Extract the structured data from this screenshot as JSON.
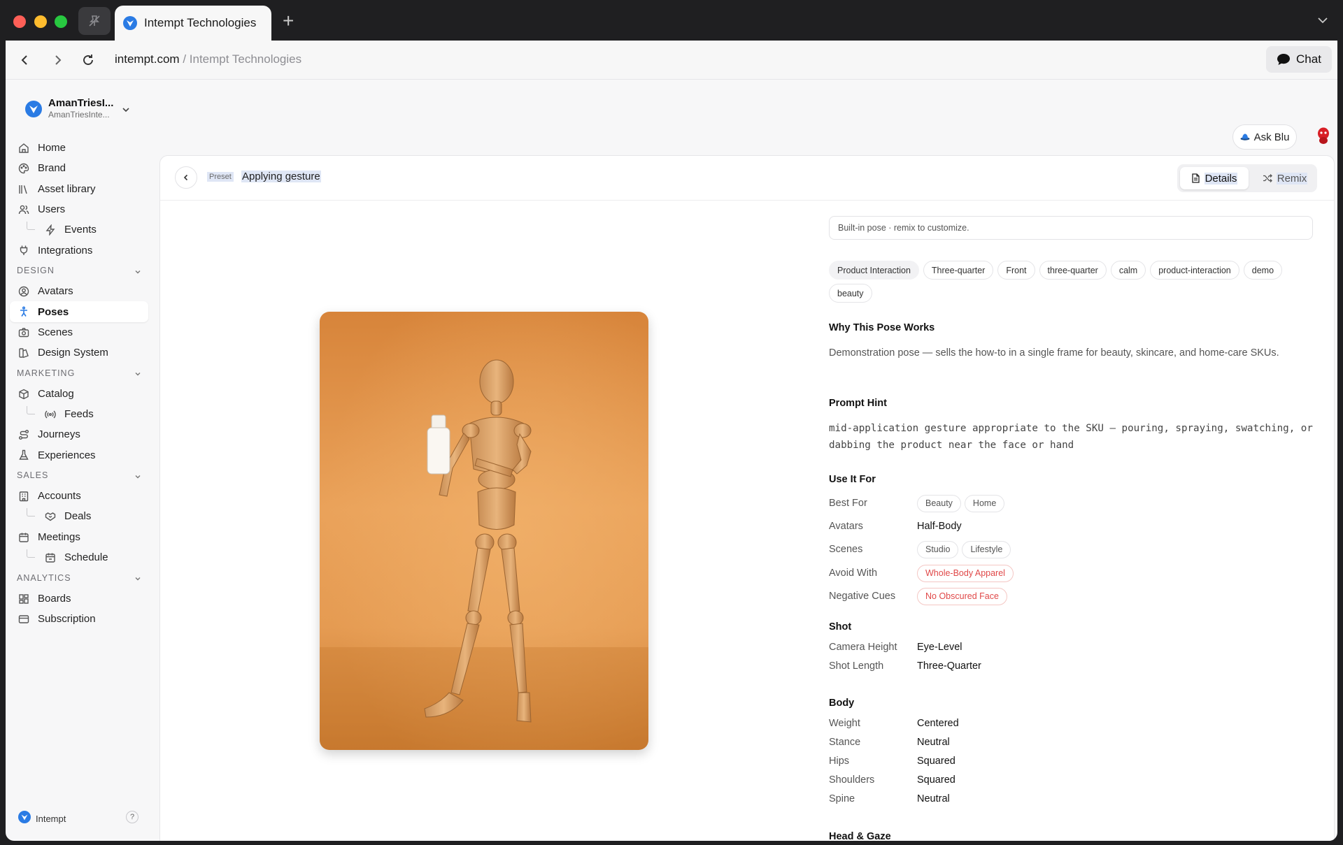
{
  "browser": {
    "tab_title": "Intempt Technologies",
    "url_domain": "intempt.com",
    "url_separator": " / ",
    "url_page_title": "Intempt Technologies",
    "chat_label": "Chat"
  },
  "org": {
    "name": "AmanTriesI...",
    "subtitle": "AmanTriesInte..."
  },
  "sidebar": {
    "items": [
      {
        "label": "Home"
      },
      {
        "label": "Brand"
      },
      {
        "label": "Asset library"
      },
      {
        "label": "Users"
      },
      {
        "label": "Events"
      },
      {
        "label": "Integrations"
      }
    ],
    "design_section": "DESIGN",
    "design_items": [
      {
        "label": "Avatars"
      },
      {
        "label": "Poses"
      },
      {
        "label": "Scenes"
      },
      {
        "label": "Design System"
      }
    ],
    "marketing_section": "MARKETING",
    "marketing_items": [
      {
        "label": "Catalog"
      },
      {
        "label": "Feeds"
      },
      {
        "label": "Journeys"
      },
      {
        "label": "Experiences"
      }
    ],
    "sales_section": "SALES",
    "sales_items": [
      {
        "label": "Accounts"
      },
      {
        "label": "Deals"
      },
      {
        "label": "Meetings"
      },
      {
        "label": "Schedule"
      }
    ],
    "analytics_section": "ANALYTICS",
    "analytics_items": [
      {
        "label": "Boards"
      },
      {
        "label": "Subscription"
      }
    ],
    "footer_label": "Intempt",
    "help": "?"
  },
  "topbar": {
    "ask_blu": "Ask Blu"
  },
  "header": {
    "preset_tag": "Preset",
    "title": "Applying gesture",
    "details_label": "Details",
    "remix_label": "Remix"
  },
  "details": {
    "note": "Built-in pose · remix to customize.",
    "tags": [
      "Product Interaction",
      "Three-quarter",
      "Front",
      "three-quarter",
      "calm",
      "product-interaction",
      "demo",
      "beauty"
    ],
    "why_title": "Why This Pose Works",
    "why_text": "Demonstration pose — sells the how-to in a single frame for beauty, skincare, and home-care SKUs.",
    "hint_title": "Prompt Hint",
    "hint_text": "mid-application gesture appropriate to the SKU — pouring, spraying, swatching, or dabbing the product near the face or hand",
    "use_title": "Use It For",
    "use": {
      "best_for_label": "Best For",
      "best_for": [
        "Beauty",
        "Home"
      ],
      "avatars_label": "Avatars",
      "avatars": "Half-Body",
      "scenes_label": "Scenes",
      "scenes": [
        "Studio",
        "Lifestyle"
      ],
      "avoid_label": "Avoid With",
      "avoid": "Whole-Body Apparel",
      "negative_label": "Negative Cues",
      "negative": "No Obscured Face"
    },
    "shot_title": "Shot",
    "shot": {
      "camera_label": "Camera Height",
      "camera": "Eye-Level",
      "length_label": "Shot Length",
      "length": "Three-Quarter"
    },
    "body_title": "Body",
    "body": {
      "weight_label": "Weight",
      "weight": "Centered",
      "stance_label": "Stance",
      "stance": "Neutral",
      "hips_label": "Hips",
      "hips": "Squared",
      "shoulders_label": "Shoulders",
      "shoulders": "Squared",
      "spine_label": "Spine",
      "spine": "Neutral"
    },
    "head_title": "Head & Gaze"
  },
  "colors": {
    "accent": "#2a7be4",
    "danger": "#e04848",
    "photo_bg": "#e8a054"
  }
}
